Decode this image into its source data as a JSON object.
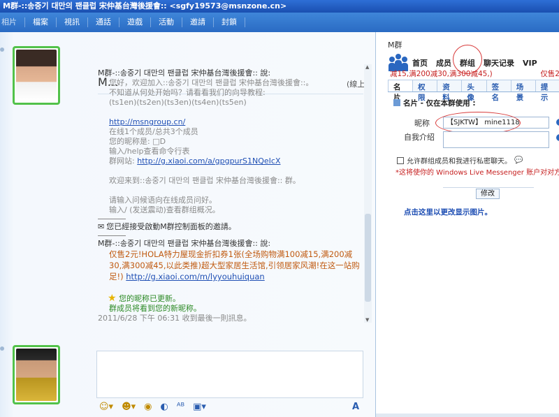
{
  "window": {
    "title": "M群-::송중기 대만의 팬클럽 宋仲基台灣後援會:: <sgfy19573@msnzone.cn>"
  },
  "menu": [
    "相片",
    "檔案",
    "視訊",
    "通話",
    "遊戲",
    "活動",
    "邀請",
    "封鎖"
  ],
  "conversation": {
    "contact_name": "M...",
    "status": "(線上)",
    "sender1": "M群-::송중기 대만의 팬클럽 宋仲基台灣後援會:: 說:",
    "welcome_lines": [
      "您好，欢迎加入::송중기 대만의 팬클럽 宋仲基台灣後援會::。",
      "不知道从何处开始吗？请看看我们的向导教程:",
      "(ts1en)(ts2en)(ts3en)(ts4en)(ts5en)"
    ],
    "group_link": "http://msngroup.cn/",
    "info_lines": [
      "在线1个成员/总共3个成员",
      "您的昵称是: □D",
      "输入/help查看命令行表"
    ],
    "site_label": "群网站: ",
    "site_link": "http://g.xiaoi.com/a/gpgpurS1NQeIcX",
    "welcome2": "欢迎来到::송중기 대만의 팬클럽 宋仲基台灣後援會:: 群。",
    "tips": [
      "请输入问候语向在线成员问好。",
      "输入/ (发送震动)查看群组概况。"
    ],
    "system_message": "您已經接受啟動M群控制面板的邀請。",
    "sender2": "M群-::송중기 대만의 팬클럽 宋仲基台灣後援會:: 說:",
    "promo_text": "仅售2元!HOLA特力屋现金折扣券1张(全场购物满100减15,满200减30,满300减45,以此类推)超大型家居生活馆,引领居家风潮!在这一站购足!)",
    "promo_link": "http://g.xiaoi.com/m/lyyouhuiquan",
    "nickname_updated": "您的昵称已更新。",
    "members_notice": "群成员将看到您的新昵称。",
    "timestamp": "2011/6/28 下午 06:31 收到最後一則訊息。"
  },
  "panel": {
    "title": "M群",
    "nav": [
      "首页",
      "成员",
      "群组",
      "聊天记录",
      "VIP"
    ],
    "ticker_left": "减15,满200减30,满300减45,)",
    "ticker_right": "仅售2",
    "tabs": [
      "名片",
      "权限",
      "资料",
      "头像",
      "签名",
      "场景",
      "提示"
    ],
    "section_title": "名片 - 仅在本群使用 :",
    "nickname_label": "昵称",
    "nickname_value": "【SJKTW】 mine1118",
    "intro_label": "自我介绍",
    "intro_value": "",
    "allow_private_label": "允许群组成员和我进行私密聊天。",
    "warning": "*这将使你的 Windows Live Messenger 账户对对方可",
    "modify_button": "修改",
    "change_image_link": "点击这里以更改显示图片。"
  },
  "colors": {
    "titlebar": "#1a4fb0",
    "accent": "#2a67c0",
    "annotation_red": "#d83a3a",
    "promo_orange": "#c05a10",
    "link_blue": "#1f4fb4",
    "avatar_border": "#52c24a"
  }
}
